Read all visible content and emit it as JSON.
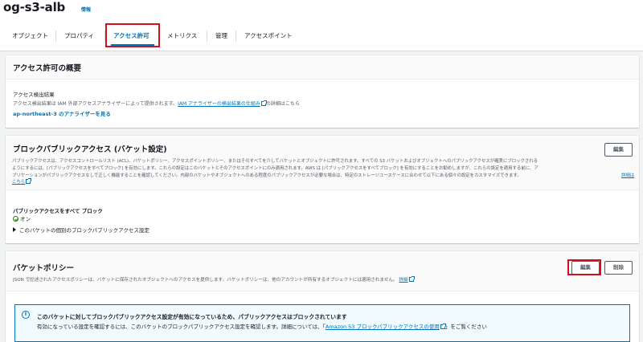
{
  "header": {
    "title": "og-s3-alb",
    "info_link": "情報"
  },
  "tabs": [
    {
      "label": "オブジェクト"
    },
    {
      "label": "プロパティ"
    },
    {
      "label": "アクセス許可"
    },
    {
      "label": "メトリクス"
    },
    {
      "label": "管理"
    },
    {
      "label": "アクセスポイント"
    }
  ],
  "overview": {
    "title": "アクセス許可の概要",
    "result_label": "アクセス検出結果",
    "desc_prefix": "アクセス検出結果は IAM 外部アクセスアナライザーによって提供されます。",
    "desc_link": "IAM アナライザーの検出結果の仕組み",
    "desc_suffix": "の詳細はこちら",
    "analyzer_link": "ap-northeast-3 のアナライザーを見る"
  },
  "block_public": {
    "title": "ブロックパブリックアクセス (バケット設定)",
    "edit_button": "編集",
    "desc_line1": "パブリックアクセスは、アクセスコントロールリスト (ACL)、バケットポリシー、アクセスポイントポリシー、またはそのすべてを介してバケットとオブジェクトに許可されます。すべての S3 バケットおよびオブジェクトへのパブリックアクセスが確実にブロックされる",
    "desc_line2": "ようにするには、[パブリックアクセスをすべてブロック] を有効にします。これらの設定はこのバケットとそのアクセスポイントにのみ適用されます。AWS は [パブリックアクセスをすべてブロック] を有効にすることをお勧めしますが、これらの設定を適用する前に、ア",
    "desc_line3": "プリケーションがパブリックアクセスなしで正しく機能することを確認してください。内部のバケットやオブジェクトへのある程度のパブリックアクセスが必要な場合は、特定のストレージユースケースに合わせて以下にある個々の設定をカスタマイズできます。",
    "desc_link_part1": "詳細は",
    "desc_link_part2": "こちら",
    "block_all_label": "パブリックアクセスをすべて ブロック",
    "status": "オン",
    "expand_label": "このバケットの個別のブロックパブリックアクセス設定"
  },
  "bucket_policy": {
    "title": "バケットポリシー",
    "edit_button": "編集",
    "delete_button": "削除",
    "desc": "JSON で記述されたアクセスポリシーは、バケットに保存されたオブジェクトへのアクセスを提供します。バケットポリシーは、他のアカウントが所有するオブジェクトには適用されません。",
    "desc_link": "詳細",
    "alert_title": "このバケットに対してブロックパブリックアクセス設定が有効になっているため、パブリックアクセスはブロックされています",
    "alert_body_prefix": "有効になっている設定を確認するには、このバケットのブロックパブリックアクセス設定を確認します。詳細については、「",
    "alert_body_link": "Amazon S3 ブロックパブリックアクセスの使用",
    "alert_body_suffix": "」をご覧ください"
  },
  "colors": {
    "accent": "#0073bb",
    "highlight": "#d1101f",
    "success": "#1d8102"
  }
}
